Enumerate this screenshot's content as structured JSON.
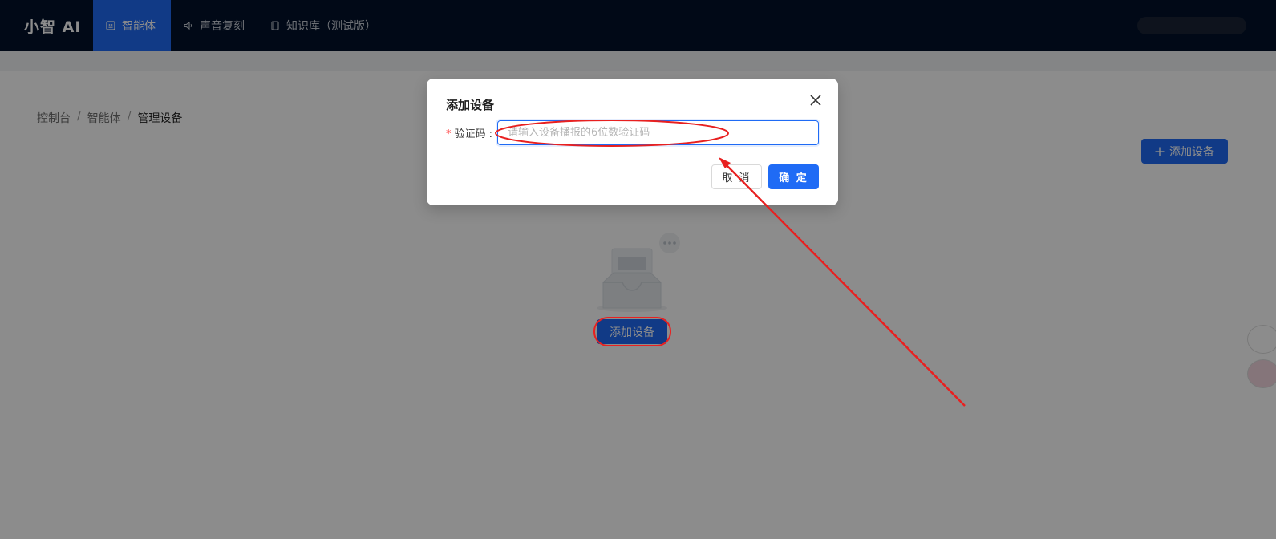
{
  "header": {
    "logo": "小智 AI",
    "nav": [
      {
        "label": "智能体",
        "icon": "robot-icon",
        "active": true
      },
      {
        "label": "声音复刻",
        "icon": "speaker-icon",
        "active": false
      },
      {
        "label": "知识库（测试版）",
        "icon": "book-icon",
        "active": false
      }
    ]
  },
  "breadcrumb": {
    "items": [
      "控制台",
      "智能体",
      "管理设备"
    ],
    "separator": "/"
  },
  "main": {
    "add_device_top": "添加设备",
    "add_device_center": "添加设备"
  },
  "modal": {
    "title": "添加设备",
    "field_label": "验证码",
    "required_mark": "*",
    "colon": ":",
    "input_value": "",
    "input_placeholder": "请输入设备播报的6位数验证码",
    "cancel_label": "取 消",
    "ok_label": "确 定"
  },
  "colors": {
    "accent": "#1f6bf5",
    "header_bg": "#02122a",
    "annotation": "#e82020"
  }
}
